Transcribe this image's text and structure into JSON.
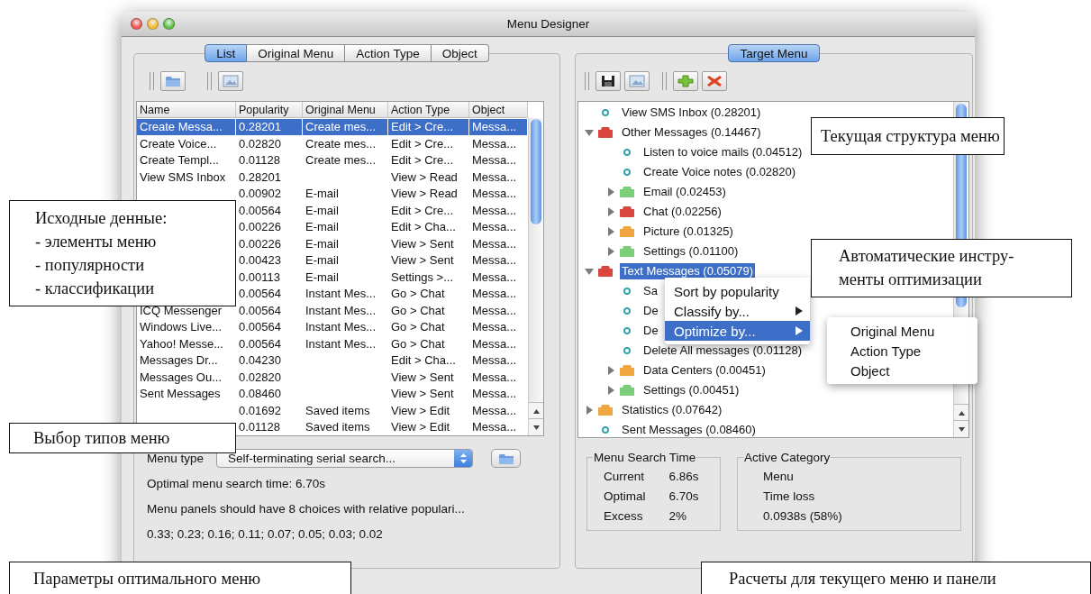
{
  "window": {
    "title": "Menu Designer"
  },
  "left_panel": {
    "tabs": [
      {
        "label": "List",
        "selected": true
      },
      {
        "label": "Original Menu",
        "selected": false
      },
      {
        "label": "Action Type",
        "selected": false
      },
      {
        "label": "Object",
        "selected": false
      }
    ],
    "table": {
      "columns": [
        "Name",
        "Popularity",
        "Original Menu",
        "Action Type",
        "Object"
      ],
      "rows": [
        {
          "name": "Create Messa...",
          "popularity": "0.28201",
          "original_menu": "Create mes...",
          "action_type": "Edit > Cre...",
          "object": "Messa...",
          "selected": true
        },
        {
          "name": "Create Voice...",
          "popularity": "0.02820",
          "original_menu": "Create mes...",
          "action_type": "Edit > Cre...",
          "object": "Messa...",
          "selected": false
        },
        {
          "name": "Create Templ...",
          "popularity": "0.01128",
          "original_menu": "Create mes...",
          "action_type": "Edit > Cre...",
          "object": "Messa...",
          "selected": false
        },
        {
          "name": "View SMS Inbox",
          "popularity": "0.28201",
          "action_type": "View > Read",
          "object": "Messa...",
          "selected": false
        },
        {
          "popularity": "0.00902",
          "original_menu": "E-mail",
          "action_type": "View > Read",
          "object": "Messa...",
          "selected": false
        },
        {
          "popularity": "0.00564",
          "original_menu": "E-mail",
          "action_type": "Edit > Cre...",
          "object": "Messa...",
          "selected": false
        },
        {
          "popularity": "0.00226",
          "original_menu": "E-mail",
          "action_type": "Edit > Cha...",
          "object": "Messa...",
          "selected": false
        },
        {
          "popularity": "0.00226",
          "original_menu": "E-mail",
          "action_type": "View > Sent",
          "object": "Messa...",
          "selected": false
        },
        {
          "popularity": "0.00423",
          "original_menu": "E-mail",
          "action_type": "View > Sent",
          "object": "Messa...",
          "selected": false
        },
        {
          "popularity": "0.00113",
          "original_menu": "E-mail",
          "action_type": "Settings >...",
          "object": "Messa...",
          "selected": false
        },
        {
          "popularity": "0.00564",
          "original_menu": "Instant Mes...",
          "action_type": "Go > Chat",
          "object": "Messa...",
          "selected": false
        },
        {
          "name": "ICQ Messenger",
          "popularity": "0.00564",
          "original_menu": "Instant Mes...",
          "action_type": "Go > Chat",
          "object": "Messa...",
          "selected": false
        },
        {
          "name": "Windows Live...",
          "popularity": "0.00564",
          "original_menu": "Instant Mes...",
          "action_type": "Go > Chat",
          "object": "Messa...",
          "selected": false
        },
        {
          "name": "Yahoo! Messe...",
          "popularity": "0.00564",
          "original_menu": "Instant Mes...",
          "action_type": "Go > Chat",
          "object": "Messa...",
          "selected": false
        },
        {
          "name": "Messages Dr...",
          "popularity": "0.04230",
          "action_type": "Edit > Cha...",
          "object": "Messa...",
          "selected": false
        },
        {
          "name": "Messages Ou...",
          "popularity": "0.02820",
          "action_type": "View > Sent",
          "object": "Messa...",
          "selected": false
        },
        {
          "name": "Sent Messages",
          "popularity": "0.08460",
          "action_type": "View > Sent",
          "object": "Messa...",
          "selected": false
        },
        {
          "popularity": "0.01692",
          "original_menu": "Saved items",
          "action_type": "View > Edit",
          "object": "Messa...",
          "selected": false
        },
        {
          "popularity": "0.01128",
          "original_menu": "Saved items",
          "action_type": "View > Edit",
          "object": "Messa...",
          "selected": false
        }
      ]
    },
    "menu_type": {
      "label": "Menu type",
      "value": "Self-terminating serial search..."
    },
    "info": [
      "Optimal menu search time: 6.70s",
      "Menu panels should have 8 choices with relative populari...",
      "0.33; 0.23; 0.16; 0.11; 0.07; 0.05; 0.03; 0.02"
    ]
  },
  "right_panel": {
    "tabs": [
      {
        "label": "Target Menu",
        "selected": true
      }
    ],
    "tree": [
      {
        "kind": "leaf",
        "label": "View SMS Inbox (0.28201)",
        "selected": false
      },
      {
        "kind": "folder",
        "label": "Other Messages (0.14467)",
        "color": "#d9453f",
        "expanded": true,
        "selected": false,
        "children": [
          {
            "kind": "leaf",
            "label": "Listen to voice mails (0.04512)",
            "selected": false
          },
          {
            "kind": "leaf",
            "label": "Create Voice notes (0.02820)",
            "selected": false
          },
          {
            "kind": "folder",
            "label": "Email (0.02453)",
            "color": "#7ccf7a",
            "expanded": false,
            "selected": false
          },
          {
            "kind": "folder",
            "label": "Chat (0.02256)",
            "color": "#d9453f",
            "expanded": false,
            "selected": false
          },
          {
            "kind": "folder",
            "label": "Picture (0.01325)",
            "color": "#f0a640",
            "expanded": false,
            "selected": false
          },
          {
            "kind": "folder",
            "label": "Settings (0.01100)",
            "color": "#7ccf7a",
            "expanded": false,
            "selected": false
          }
        ]
      },
      {
        "kind": "folder",
        "label": "Text Messages (0.05079)",
        "color": "#d9453f",
        "expanded": true,
        "selected": true,
        "children": [
          {
            "kind": "leaf",
            "label": "Sa",
            "selected": false
          },
          {
            "kind": "leaf",
            "label": "De",
            "selected": false
          },
          {
            "kind": "leaf",
            "label": "De",
            "selected": false
          },
          {
            "kind": "leaf",
            "label": "Delete All messages (0.01128)",
            "selected": false
          },
          {
            "kind": "folder",
            "label": "Data Centers (0.00451)",
            "color": "#f0a640",
            "expanded": false,
            "selected": false
          },
          {
            "kind": "folder",
            "label": "Settings (0.00451)",
            "color": "#7ccf7a",
            "expanded": false,
            "selected": false
          }
        ]
      },
      {
        "kind": "folder",
        "label": "Statistics (0.07642)",
        "color": "#f0a640",
        "expanded": false,
        "selected": false
      },
      {
        "kind": "leaf",
        "label": "Sent Messages (0.08460)",
        "selected": false
      }
    ],
    "context_menu": {
      "items": [
        {
          "label": "Sort by popularity",
          "submenu": false,
          "selected": false
        },
        {
          "label": "Classify by...",
          "submenu": true,
          "selected": false
        },
        {
          "label": "Optimize by...",
          "submenu": true,
          "selected": true
        }
      ],
      "submenu": [
        {
          "label": "Original Menu",
          "selected": false
        },
        {
          "label": "Action Type",
          "selected": false
        },
        {
          "label": "Object",
          "selected": false
        }
      ]
    },
    "search_time": {
      "title": "Menu Search Time",
      "rows": [
        {
          "label": "Current",
          "value": "6.86s"
        },
        {
          "label": "Optimal",
          "value": "6.70s"
        },
        {
          "label": "Excess",
          "value": "2%"
        }
      ]
    },
    "active_category": {
      "title": "Active Category",
      "lines": [
        "Menu",
        "Time loss",
        "0.0938s (58%)"
      ]
    }
  },
  "annotations": [
    {
      "lines": [
        "Исходные денные:",
        "- элементы меню",
        "- популярности",
        "- классификации"
      ]
    },
    {
      "lines": [
        "Выбор типов меню"
      ]
    },
    {
      "lines": [
        "Параметры оптимального меню"
      ]
    },
    {
      "lines": [
        "Текущая структура меню"
      ]
    },
    {
      "lines": [
        "Автоматические инстру-",
        "менты оптимизации"
      ]
    },
    {
      "lines": [
        "Расчеты для текущего меню и панели"
      ]
    }
  ]
}
